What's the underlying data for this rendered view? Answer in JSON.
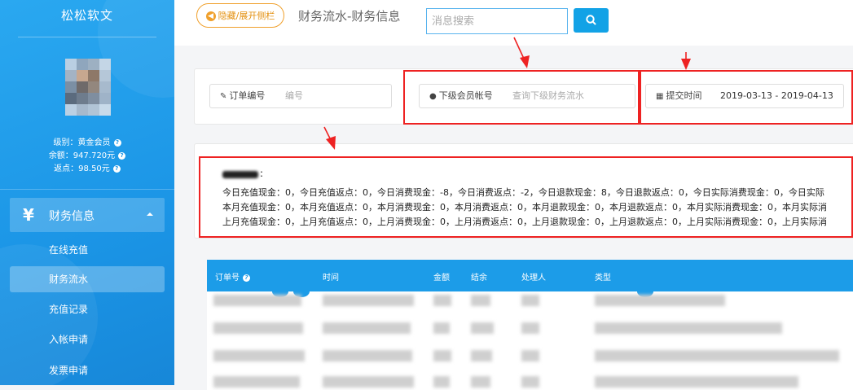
{
  "sidebar": {
    "app_title": "松松软文",
    "user": {
      "level": "级别：黄金会员",
      "balance": "余额：947.720元",
      "rebate": "返点：98.50元"
    },
    "menu": {
      "icon": "yen-icon",
      "label": "财务信息",
      "items": [
        {
          "label": "在线充值",
          "active": false
        },
        {
          "label": "财务流水",
          "active": true
        },
        {
          "label": "充值记录",
          "active": false
        },
        {
          "label": "入帐申请",
          "active": false
        },
        {
          "label": "发票申请",
          "active": false
        }
      ]
    }
  },
  "topbar": {
    "toggle_label": "隐藏/展开侧栏",
    "page_title": "财务流水-财务信息",
    "search_placeholder": "消息搜索"
  },
  "filters": {
    "order": {
      "label": "订单编号",
      "placeholder": "编号"
    },
    "member": {
      "label": "下级会员帐号",
      "placeholder": "查询下级财务流水"
    },
    "time": {
      "label": "提交时间",
      "value": "2019-03-13 - 2019-04-13"
    }
  },
  "stats": {
    "line_today": "今日充值现金：0，今日充值返点：0，今日消费现金：-8，今日消费返点：-2，今日退款现金：8，今日退款返点：0，今日实际消费现金：0，今日实际",
    "line_month": "本月充值现金：0，本月充值返点：0，本月消费现金：0，本月消费返点：0，本月退款现金：0，本月退款返点：0，本月实际消费现金：0，本月实际消",
    "line_last_month": "上月充值现金：0，上月充值返点：0，上月消费现金：0，上月消费返点：0，上月退款现金：0，上月退款返点：0，上月实际消费现金：0，上月实际消"
  },
  "table": {
    "headers": [
      "订单号",
      "时间",
      "金额",
      "结余",
      "处理人",
      "类型"
    ]
  },
  "colors": {
    "sidebar": "#1b95e6",
    "accent": "#12a2e6",
    "toggle_orange": "#f0a02c",
    "annotation_red": "#e22222"
  }
}
